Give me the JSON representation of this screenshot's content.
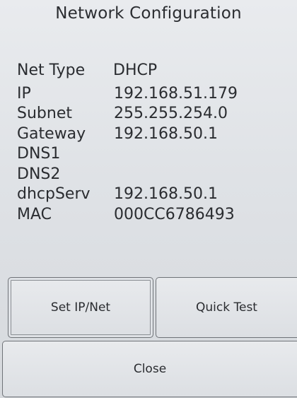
{
  "window": {
    "title": "Network Configuration"
  },
  "network": {
    "rows": [
      {
        "label": "Net Type",
        "value": "DHCP"
      },
      {
        "label": "IP",
        "value": "192.168.51.179"
      },
      {
        "label": "Subnet",
        "value": "255.255.254.0"
      },
      {
        "label": "Gateway",
        "value": "192.168.50.1"
      },
      {
        "label": "DNS1",
        "value": ""
      },
      {
        "label": "DNS2",
        "value": ""
      },
      {
        "label": "dhcpServ",
        "value": "192.168.50.1"
      },
      {
        "label": "MAC",
        "value": "000CC6786493"
      }
    ]
  },
  "buttons": {
    "set_ip": "Set IP/Net",
    "quick_test": "Quick Test",
    "close": "Close"
  }
}
